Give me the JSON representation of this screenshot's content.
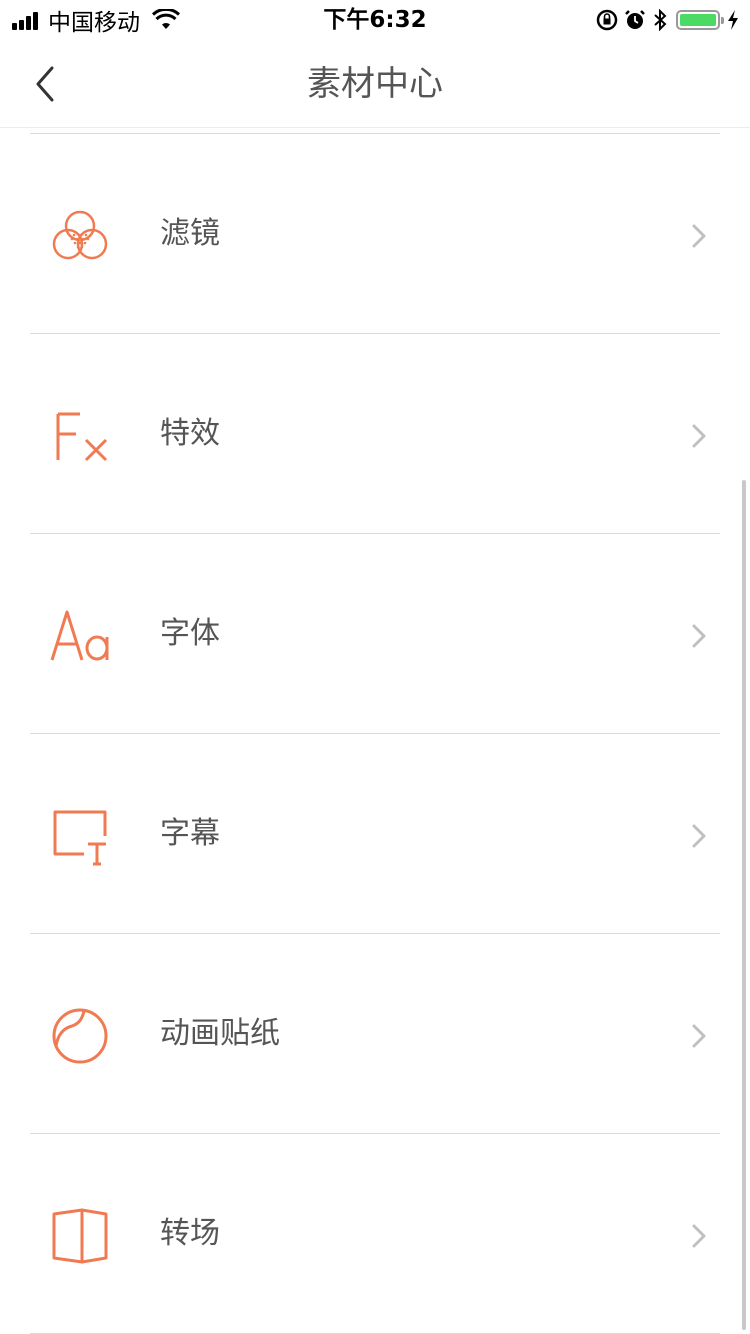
{
  "status_bar": {
    "carrier": "中国移动",
    "time": "下午6:32"
  },
  "nav": {
    "title": "素材中心"
  },
  "accent_color": "#f07a52",
  "items": [
    {
      "label": "滤镜",
      "icon": "filter-icon"
    },
    {
      "label": "特效",
      "icon": "effects-fx-icon"
    },
    {
      "label": "字体",
      "icon": "font-aa-icon"
    },
    {
      "label": "字幕",
      "icon": "subtitle-icon"
    },
    {
      "label": "动画贴纸",
      "icon": "sticker-icon"
    },
    {
      "label": "转场",
      "icon": "transition-icon"
    }
  ]
}
